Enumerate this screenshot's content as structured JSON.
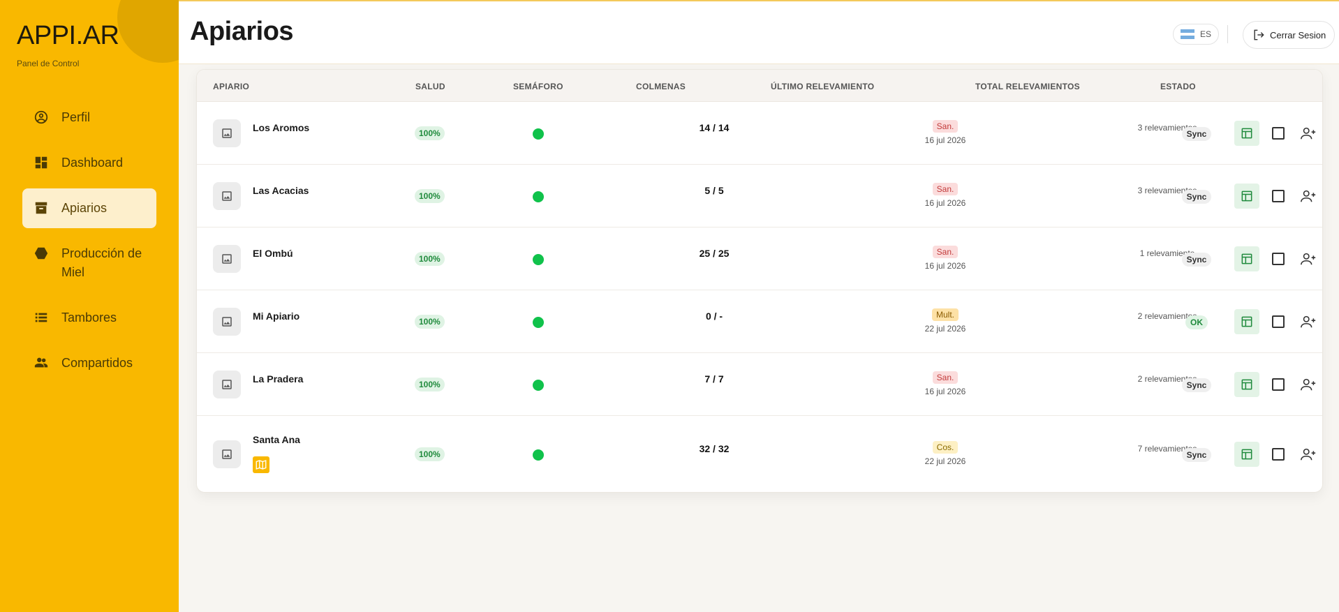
{
  "brand": {
    "title": "APPI.AR",
    "subtitle": "Panel de Control"
  },
  "sidebar": {
    "items": [
      {
        "label": "Perfil",
        "icon": "user-circle-icon",
        "active": false
      },
      {
        "label": "Dashboard",
        "icon": "dashboard-icon",
        "active": false
      },
      {
        "label": "Apiarios",
        "icon": "archive-box-icon",
        "active": true
      },
      {
        "label": "Producción de Miel",
        "icon": "hexagon-icon",
        "active": false
      },
      {
        "label": "Tambores",
        "icon": "list-icon",
        "active": false
      },
      {
        "label": "Compartidos",
        "icon": "group-icon",
        "active": false
      }
    ]
  },
  "header": {
    "title": "Apiarios",
    "language": "ES",
    "logout_label": "Cerrar Sesion"
  },
  "table": {
    "columns": [
      "APIARIO",
      "SALUD",
      "SEMÁFORO",
      "COLMENAS",
      "ÚLTIMO RELEVAMIENTO",
      "TOTAL RELEVAMIENTOS",
      "ESTADO"
    ],
    "rows": [
      {
        "name": "Los Aromos",
        "salud": "100%",
        "colmenas": "14 / 14",
        "tag": "San.",
        "tag_type": "san",
        "date": "16 jul 2026",
        "total": "3 relevamientos",
        "estado": "Sync",
        "has_map": false
      },
      {
        "name": "Las Acacias",
        "salud": "100%",
        "colmenas": "5 / 5",
        "tag": "San.",
        "tag_type": "san",
        "date": "16 jul 2026",
        "total": "3 relevamientos",
        "estado": "Sync",
        "has_map": false
      },
      {
        "name": "El Ombú",
        "salud": "100%",
        "colmenas": "25 / 25",
        "tag": "San.",
        "tag_type": "san",
        "date": "16 jul 2026",
        "total": "1 relevamiento",
        "estado": "Sync",
        "has_map": false
      },
      {
        "name": "Mi Apiario",
        "salud": "100%",
        "colmenas": "0 / -",
        "tag": "Mult.",
        "tag_type": "mult",
        "date": "22 jul 2026",
        "total": "2 relevamientos",
        "estado": "OK",
        "has_map": false
      },
      {
        "name": "La Pradera",
        "salud": "100%",
        "colmenas": "7 / 7",
        "tag": "San.",
        "tag_type": "san",
        "date": "16 jul 2026",
        "total": "2 relevamientos",
        "estado": "Sync",
        "has_map": false
      },
      {
        "name": "Santa Ana",
        "salud": "100%",
        "colmenas": "32 / 32",
        "tag": "Cos.",
        "tag_type": "cos",
        "date": "22 jul 2026",
        "total": "7 relevamientos",
        "estado": "Sync",
        "has_map": true
      }
    ]
  },
  "colors": {
    "primary": "#f9b800",
    "success": "#10c24b",
    "active_bg": "#fdefcc"
  }
}
